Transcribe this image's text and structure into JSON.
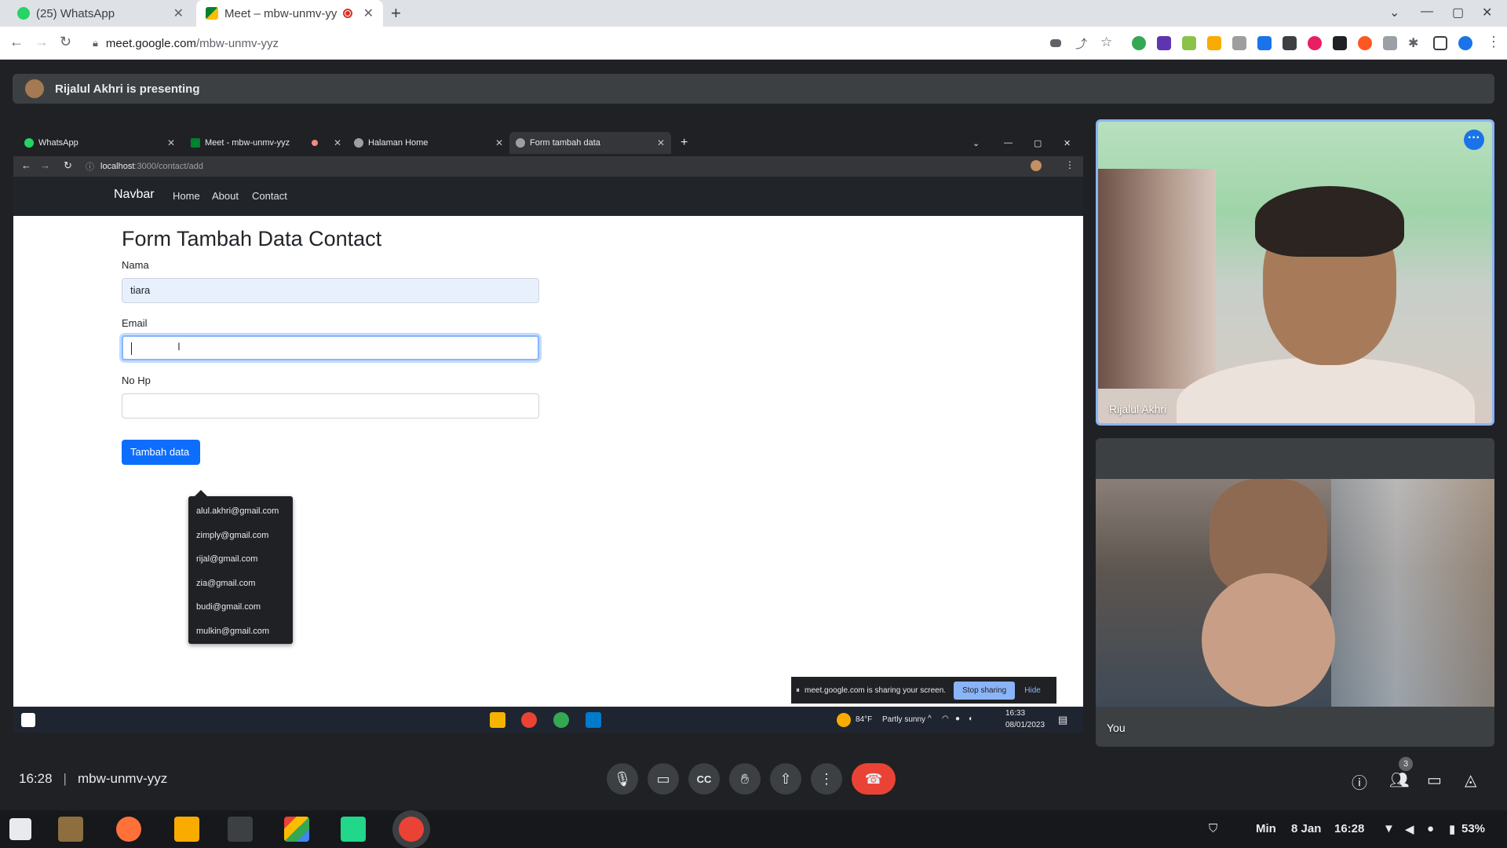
{
  "browser": {
    "tabs": [
      {
        "label": "(25) WhatsApp",
        "icon": "whatsapp-icon"
      },
      {
        "label": "Meet – mbw-unmv-yy",
        "icon": "meet-icon",
        "recording": true
      }
    ],
    "url_host": "meet.google.com",
    "url_path": "/mbw-unmv-yyz"
  },
  "presenting": {
    "text": "Rijalul Akhri is presenting"
  },
  "shared": {
    "tabs": [
      {
        "label": "WhatsApp"
      },
      {
        "label": "Meet - mbw-unmv-yyz"
      },
      {
        "label": "Halaman Home"
      },
      {
        "label": "Form tambah data"
      }
    ],
    "url_host": "localhost",
    "url_path": ":3000/contact/add",
    "navbar": {
      "brand": "Navbar",
      "links": [
        "Home",
        "About",
        "Contact"
      ]
    },
    "form": {
      "title": "Form Tambah Data Contact",
      "nama_label": "Nama",
      "nama_value": "tiara",
      "email_label": "Email",
      "email_value": "",
      "nohp_label": "No Hp",
      "submit_label": "Tambah data"
    },
    "autocomplete": [
      "alul.akhri@gmail.com",
      "zimply@gmail.com",
      "rijal@gmail.com",
      "zia@gmail.com",
      "budi@gmail.com",
      "mulkin@gmail.com"
    ],
    "sharebar": {
      "message": "meet.google.com is sharing your screen.",
      "stop": "Stop sharing",
      "hide": "Hide"
    },
    "taskbar": {
      "weather": "84°F",
      "weather_desc": "Partly sunny",
      "time": "16:33",
      "date": "08/01/2023"
    }
  },
  "participants": [
    {
      "name": "Rijalul Akhri"
    },
    {
      "name": "You"
    }
  ],
  "meeting": {
    "time": "16:28",
    "code": "mbw-unmv-yyz",
    "participant_count": "3"
  },
  "os": {
    "day": "Min",
    "date": "8 Jan",
    "time": "16:28",
    "battery": "53%"
  },
  "colors": {
    "accent": "#1a73e8",
    "end_call": "#ea4335",
    "bootstrap_primary": "#0d6efd"
  }
}
